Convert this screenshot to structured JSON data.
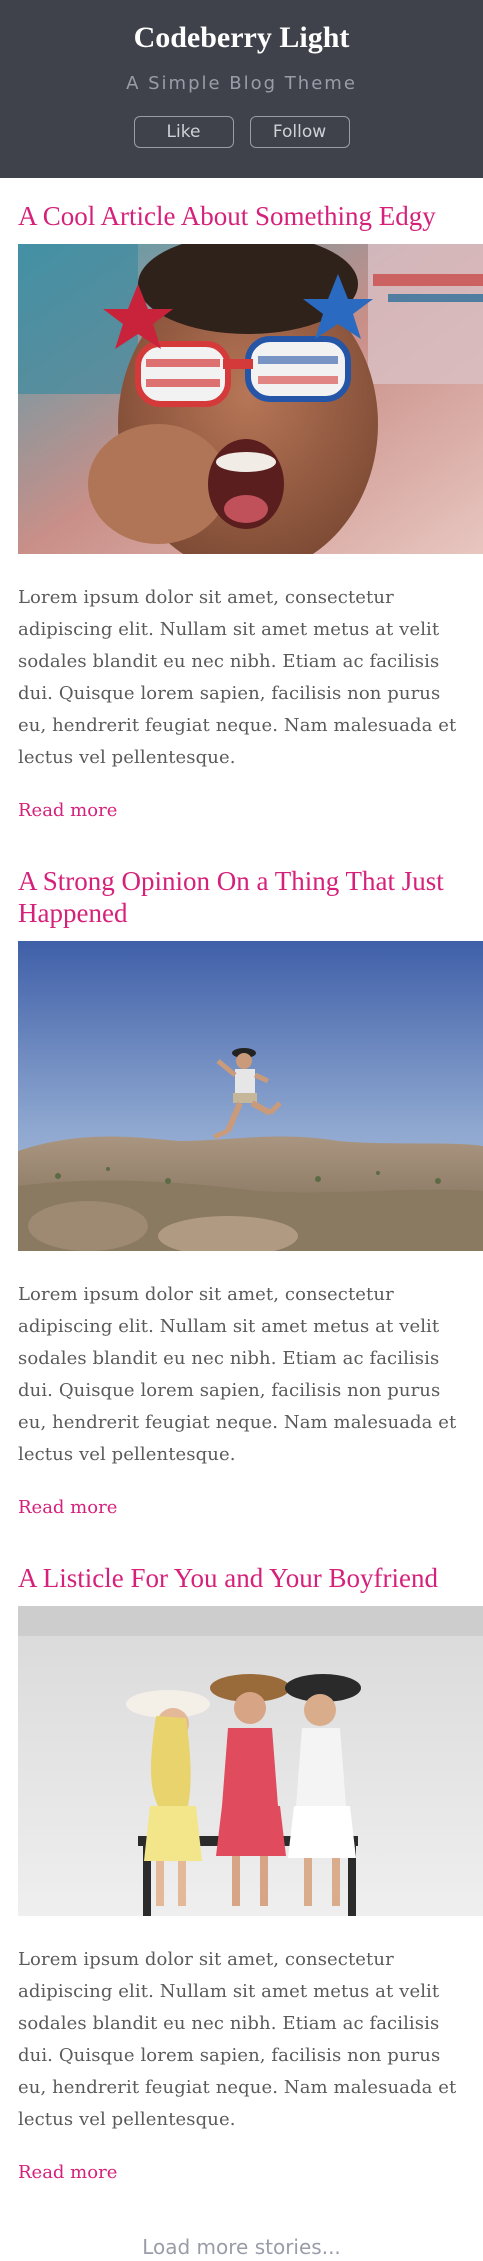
{
  "header": {
    "title": "Codeberry Light",
    "subtitle": "A Simple Blog Theme",
    "like_label": "Like",
    "follow_label": "Follow"
  },
  "posts": [
    {
      "title": "A Cool Article About Something Edgy",
      "excerpt": "Lorem ipsum dolor sit amet, consectetur adipiscing elit. Nullam sit amet metus at velit sodales blandit eu nec nibh. Etiam ac facilisis dui. Quisque lorem sapien, facilisis non purus eu, hendrerit feugiat neque. Nam malesuada et lectus vel pellentesque.",
      "read_more": "Read more"
    },
    {
      "title": "A Strong Opinion On a Thing That Just Happened",
      "excerpt": "Lorem ipsum dolor sit amet, consectetur adipiscing elit. Nullam sit amet metus at velit sodales blandit eu nec nibh. Etiam ac facilisis dui. Quisque lorem sapien, facilisis non purus eu, hendrerit feugiat neque. Nam malesuada et lectus vel pellentesque.",
      "read_more": "Read more"
    },
    {
      "title": "A Listicle For You and Your Boyfriend",
      "excerpt": "Lorem ipsum dolor sit amet, consectetur adipiscing elit. Nullam sit amet metus at velit sodales blandit eu nec nibh. Etiam ac facilisis dui. Quisque lorem sapien, facilisis non purus eu, hendrerit feugiat neque. Nam malesuada et lectus vel pellentesque.",
      "read_more": "Read more"
    }
  ],
  "load_more": "Load more stories...",
  "colors": {
    "header_bg": "#3f424a",
    "accent": "#d6217a",
    "body_text": "#5a5a5a",
    "muted": "#9a9da8"
  }
}
